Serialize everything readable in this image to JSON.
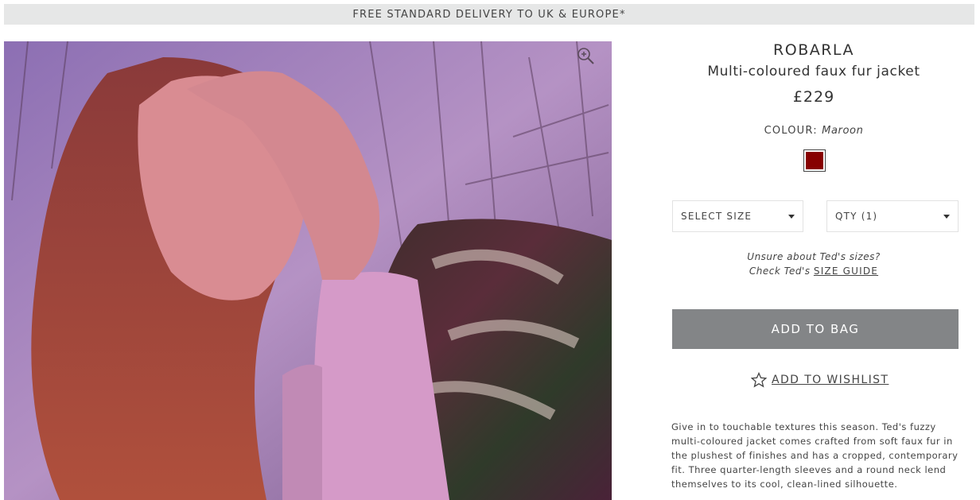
{
  "promo": {
    "text": "FREE STANDARD DELIVERY TO UK & EUROPE*"
  },
  "image": {
    "zoom_icon": "zoom-in-icon"
  },
  "product": {
    "brand": "ROBARLA",
    "name": "Multi-coloured faux fur jacket",
    "price": "£229",
    "colour_label": "COLOUR:",
    "colour_value": "Maroon",
    "swatch_color": "#870000",
    "size_select": "SELECT SIZE",
    "qty_select": "QTY (1)",
    "size_help_line1": "Unsure about Ted's sizes?",
    "size_help_prefix": "Check Ted's",
    "size_guide_link": "SIZE GUIDE",
    "add_to_bag": "ADD TO BAG",
    "wishlist_icon": "star-outline-icon",
    "wishlist": "ADD TO WISHLIST",
    "description": "Give in to touchable textures this season. Ted's fuzzy multi-coloured jacket comes crafted from soft faux fur in the plushest of finishes and has a cropped, contemporary fit. Three quarter-length sleeves and a round neck lend themselves to its cool, clean-lined silhouette."
  },
  "colors": {
    "button_bg": "#838587",
    "promo_bg": "#e6e7e7"
  }
}
